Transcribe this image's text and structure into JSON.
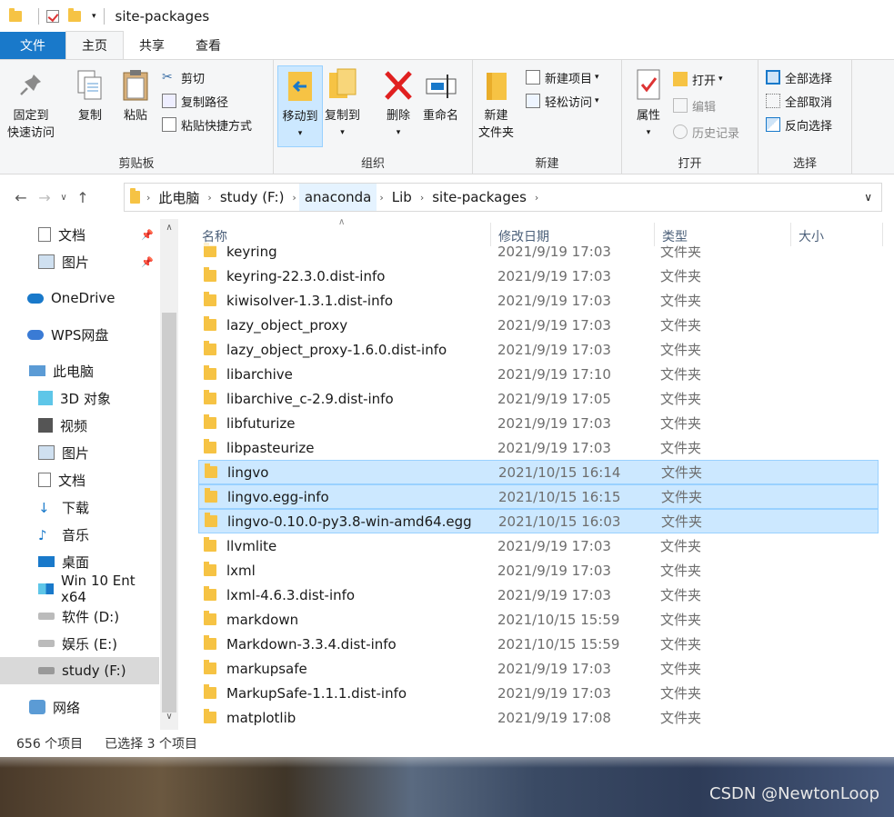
{
  "window": {
    "title": "site-packages"
  },
  "tabs": [
    {
      "label": "文件"
    },
    {
      "label": "主页"
    },
    {
      "label": "共享"
    },
    {
      "label": "查看"
    }
  ],
  "ribbon": {
    "clipboard": {
      "pin_label_1": "固定到",
      "pin_label_2": "快速访问",
      "copy": "复制",
      "paste": "粘贴",
      "cut": "剪切",
      "copy_path": "复制路径",
      "paste_shortcut": "粘贴快捷方式",
      "group": "剪贴板"
    },
    "organize": {
      "move_to": "移动到",
      "copy_to": "复制到",
      "delete": "删除",
      "rename": "重命名",
      "group": "组织"
    },
    "new": {
      "new_folder_1": "新建",
      "new_folder_2": "文件夹",
      "new_item": "新建项目",
      "easy_access": "轻松访问",
      "group": "新建"
    },
    "open": {
      "properties": "属性",
      "open": "打开",
      "edit": "编辑",
      "history": "历史记录",
      "group": "打开"
    },
    "select": {
      "select_all": "全部选择",
      "select_none": "全部取消",
      "invert": "反向选择",
      "group": "选择"
    }
  },
  "address": {
    "crumbs": [
      "此电脑",
      "study (F:)",
      "anaconda",
      "Lib",
      "site-packages"
    ]
  },
  "sidebar": {
    "items": [
      {
        "label": "文档",
        "icon": "document-icon"
      },
      {
        "label": "图片",
        "icon": "picture-icon"
      },
      {
        "label": "OneDrive",
        "icon": "cloud-icon"
      },
      {
        "label": "WPS网盘",
        "icon": "cloud-icon"
      },
      {
        "label": "此电脑",
        "icon": "computer-icon"
      },
      {
        "label": "3D 对象",
        "icon": "cube-icon"
      },
      {
        "label": "视频",
        "icon": "video-icon"
      },
      {
        "label": "图片",
        "icon": "picture-icon"
      },
      {
        "label": "文档",
        "icon": "document-icon"
      },
      {
        "label": "下载",
        "icon": "download-icon"
      },
      {
        "label": "音乐",
        "icon": "music-icon"
      },
      {
        "label": "桌面",
        "icon": "desktop-icon"
      },
      {
        "label": "Win 10 Ent x64",
        "icon": "windows-drive-icon"
      },
      {
        "label": "软件 (D:)",
        "icon": "drive-icon"
      },
      {
        "label": "娱乐 (E:)",
        "icon": "drive-icon"
      },
      {
        "label": "study (F:)",
        "icon": "drive-icon"
      },
      {
        "label": "网络",
        "icon": "network-icon"
      }
    ]
  },
  "columns": {
    "name": "名称",
    "date": "修改日期",
    "type": "类型",
    "size": "大小"
  },
  "files": [
    {
      "name": "keyring",
      "date": "2021/9/19 17:03",
      "type": "文件夹"
    },
    {
      "name": "keyring-22.3.0.dist-info",
      "date": "2021/9/19 17:03",
      "type": "文件夹"
    },
    {
      "name": "kiwisolver-1.3.1.dist-info",
      "date": "2021/9/19 17:03",
      "type": "文件夹"
    },
    {
      "name": "lazy_object_proxy",
      "date": "2021/9/19 17:03",
      "type": "文件夹"
    },
    {
      "name": "lazy_object_proxy-1.6.0.dist-info",
      "date": "2021/9/19 17:03",
      "type": "文件夹"
    },
    {
      "name": "libarchive",
      "date": "2021/9/19 17:10",
      "type": "文件夹"
    },
    {
      "name": "libarchive_c-2.9.dist-info",
      "date": "2021/9/19 17:05",
      "type": "文件夹"
    },
    {
      "name": "libfuturize",
      "date": "2021/9/19 17:03",
      "type": "文件夹"
    },
    {
      "name": "libpasteurize",
      "date": "2021/9/19 17:03",
      "type": "文件夹"
    },
    {
      "name": "lingvo",
      "date": "2021/10/15 16:14",
      "type": "文件夹"
    },
    {
      "name": "lingvo.egg-info",
      "date": "2021/10/15 16:15",
      "type": "文件夹"
    },
    {
      "name": "lingvo-0.10.0-py3.8-win-amd64.egg",
      "date": "2021/10/15 16:03",
      "type": "文件夹"
    },
    {
      "name": "llvmlite",
      "date": "2021/9/19 17:03",
      "type": "文件夹"
    },
    {
      "name": "lxml",
      "date": "2021/9/19 17:03",
      "type": "文件夹"
    },
    {
      "name": "lxml-4.6.3.dist-info",
      "date": "2021/9/19 17:03",
      "type": "文件夹"
    },
    {
      "name": "markdown",
      "date": "2021/10/15 15:59",
      "type": "文件夹"
    },
    {
      "name": "Markdown-3.3.4.dist-info",
      "date": "2021/10/15 15:59",
      "type": "文件夹"
    },
    {
      "name": "markupsafe",
      "date": "2021/9/19 17:03",
      "type": "文件夹"
    },
    {
      "name": "MarkupSafe-1.1.1.dist-info",
      "date": "2021/9/19 17:03",
      "type": "文件夹"
    },
    {
      "name": "matplotlib",
      "date": "2021/9/19 17:08",
      "type": "文件夹"
    }
  ],
  "status": {
    "count": "656 个项目",
    "selected": "已选择 3 个项目"
  },
  "watermark": "CSDN @NewtonLoop",
  "colors": {
    "accent": "#1979ca",
    "selection": "#cce8ff",
    "folder": "#f6c344"
  }
}
